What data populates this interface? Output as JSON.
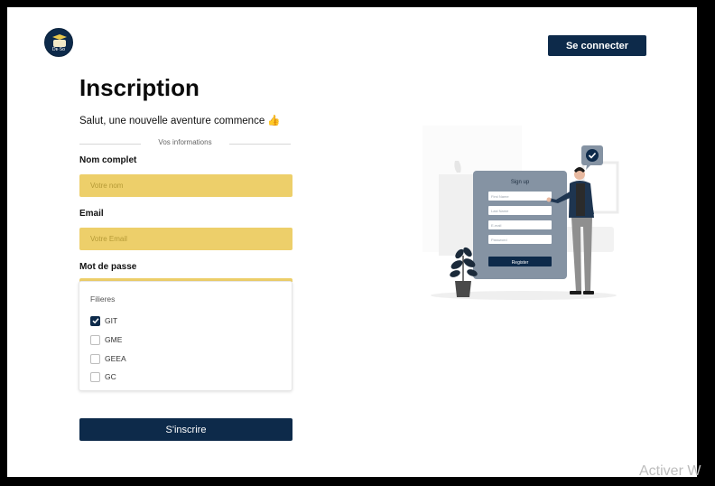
{
  "brand": {
    "logo_text": "Dᴇ·Sᴏ"
  },
  "header": {
    "login_label": "Se connecter"
  },
  "form": {
    "title": "Inscription",
    "subtitle": "Salut, une nouvelle aventure commence 👍",
    "section_label": "Vos informations",
    "name_label": "Nom complet",
    "name_placeholder": "Votre nom",
    "email_label": "Email",
    "email_placeholder": "Votre Email",
    "password_label": "Mot de passe",
    "submit_label": "S'inscrire"
  },
  "filieres": {
    "title": "Filieres",
    "options": [
      {
        "label": "GIT",
        "checked": true
      },
      {
        "label": "GME",
        "checked": false
      },
      {
        "label": "GEEA",
        "checked": false
      },
      {
        "label": "GC",
        "checked": false
      }
    ]
  },
  "illustration": {
    "card_title": "Sign up",
    "fields": [
      "First Name",
      "Last Name",
      "E-mail",
      "Password"
    ],
    "button": "Register"
  },
  "watermark": "Activer W",
  "colors": {
    "navy": "#0d2a4a",
    "yellow": "#edcf6a"
  }
}
